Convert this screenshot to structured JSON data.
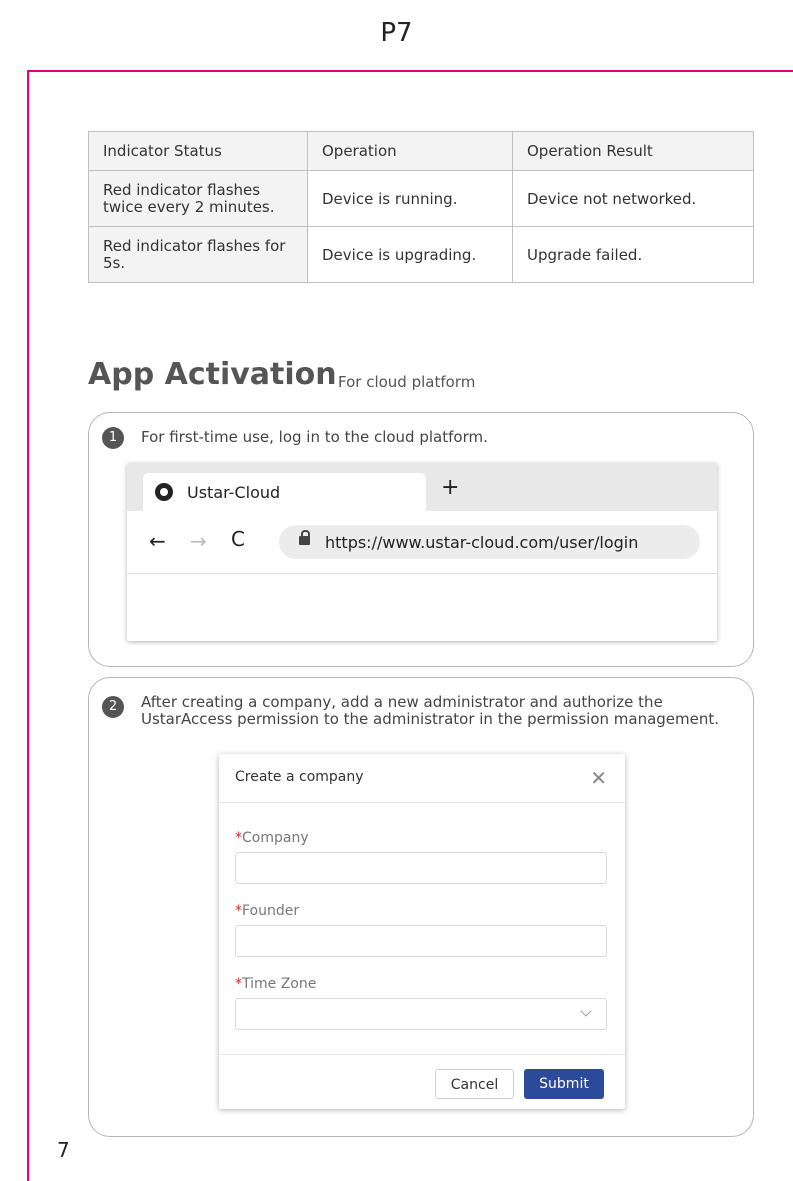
{
  "header": {
    "page_label": "P7"
  },
  "table": {
    "headers": [
      "Indicator Status",
      "Operation",
      "Operation Result"
    ],
    "rows": [
      [
        "Red indicator flashes twice every 2 minutes.",
        "Device is running.",
        "Device not networked."
      ],
      [
        "Red indicator flashes for 5s.",
        "Device is upgrading.",
        "Upgrade failed."
      ]
    ]
  },
  "section": {
    "title": "App Activation",
    "subtitle": "For cloud platform"
  },
  "step1": {
    "number": "1",
    "text": "For first-time use, log in to the cloud platform.",
    "browser": {
      "tab_title": "Ustar-Cloud",
      "new_tab": "+",
      "back": "←",
      "forward": "→",
      "reload": "C",
      "url": "https://www.ustar-cloud.com/user/login"
    }
  },
  "step2": {
    "number": "2",
    "text_line1": "After creating a company, add a new administrator and authorize the",
    "text_line2": "UstarAccess permission to the administrator in the permission management.",
    "dialog": {
      "title": "Create a company",
      "close": "✕",
      "required_mark": "*",
      "fields": [
        {
          "label": "Company",
          "value": ""
        },
        {
          "label": "Founder",
          "value": ""
        },
        {
          "label": "Time Zone",
          "value": ""
        }
      ],
      "cancel_label": "Cancel",
      "submit_label": "Submit"
    }
  },
  "footer": {
    "page_number": "7"
  },
  "colors": {
    "accent_pink": "#e6007e",
    "submit_blue": "#2b4a9a",
    "required_red": "#e0242c"
  }
}
